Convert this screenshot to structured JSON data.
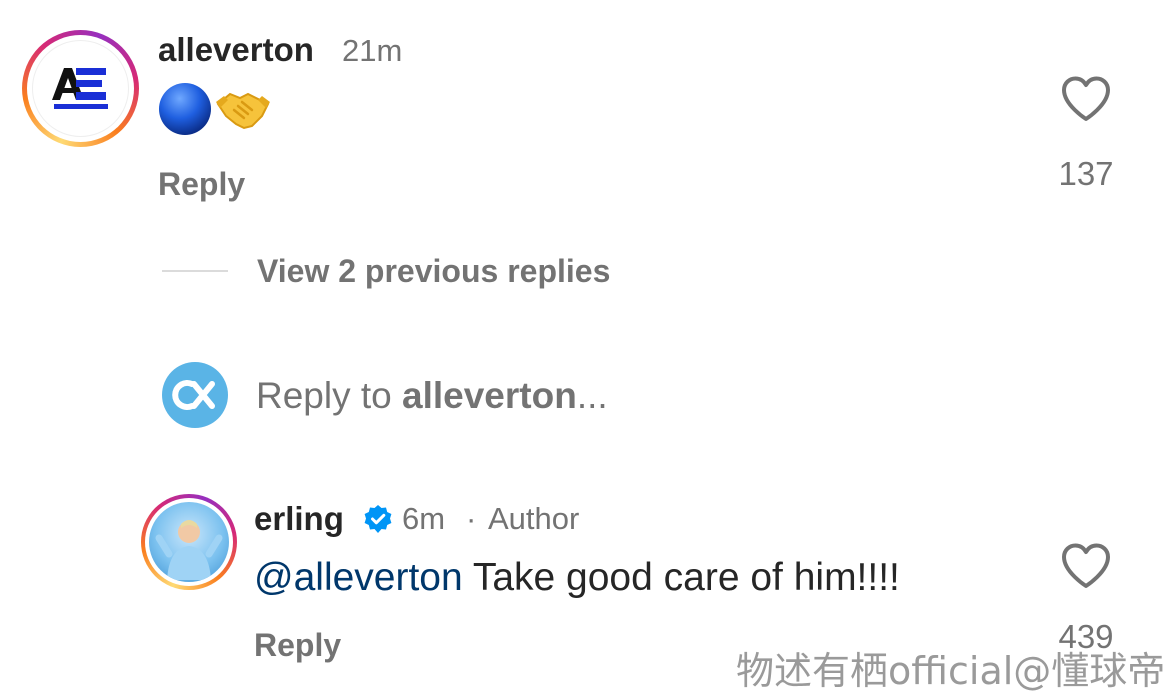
{
  "comments": [
    {
      "username": "alleverton",
      "time": "21m",
      "emoji_text": "🔵🤝",
      "avatar_logo_text": "ALLEVERTON",
      "reply_label": "Reply",
      "like_count": "137"
    },
    {
      "username": "erling",
      "verified": true,
      "time": "6m",
      "separator": "·",
      "badge": "Author",
      "mention": "@alleverton",
      "text": " Take good care of him!!!!",
      "reply_label": "Reply",
      "like_count": "439"
    }
  ],
  "view_replies": {
    "label": "View 2 previous replies"
  },
  "composer": {
    "prefix": "Reply to ",
    "target": "alleverton",
    "suffix": "..."
  },
  "watermark": "物述有栖official@懂球帝",
  "colors": {
    "mention": "#00376b",
    "verified": "#0095f6",
    "secondary_text": "#737373",
    "composer_avatar": "#5ab4e6"
  },
  "icons": {
    "like": "heart-outline-icon",
    "verified": "verified-badge-icon"
  }
}
